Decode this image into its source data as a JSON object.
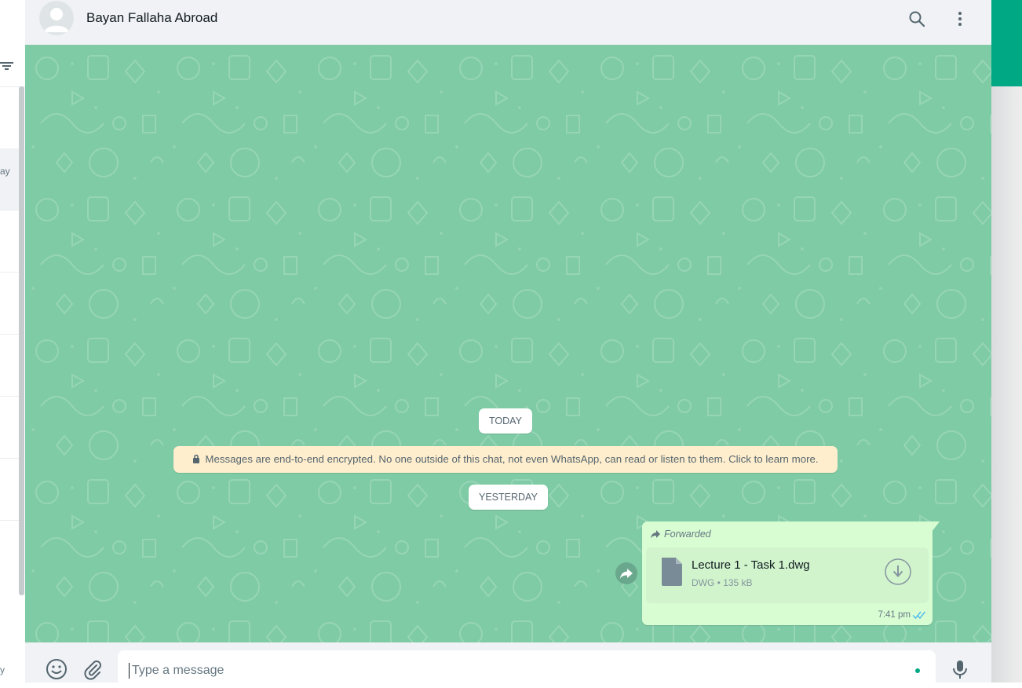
{
  "header": {
    "contact_name": "Bayan Fallaha Abroad",
    "icons": [
      "search-icon",
      "menu-icon"
    ]
  },
  "sidebar": {
    "slices": [
      {
        "text": "ay",
        "active": true
      },
      {
        "text": "",
        "active": false
      },
      {
        "text": "",
        "active": false
      },
      {
        "text": "",
        "active": false
      },
      {
        "text": "",
        "active": false
      },
      {
        "text": "",
        "active": false
      },
      {
        "text": "y",
        "active": false
      }
    ]
  },
  "conversation": {
    "date_today": "TODAY",
    "encryption_notice": "Messages are end-to-end encrypted. No one outside of this chat, not even WhatsApp, can read or listen to them. Click to learn more.",
    "date_yesterday": "YESTERDAY",
    "message": {
      "forwarded_label": "Forwarded",
      "file_name": "Lecture 1 - Task 1.dwg",
      "file_type": "DWG",
      "file_size": "135 kB",
      "time": "7:41 pm",
      "status": "read"
    }
  },
  "footer": {
    "input_placeholder": "Type a message"
  },
  "colors": {
    "conversation_bg": "#7ecba5",
    "outgoing_bubble": "#d9fdd3",
    "accent": "#00a884",
    "read_ticks": "#53bdeb"
  }
}
